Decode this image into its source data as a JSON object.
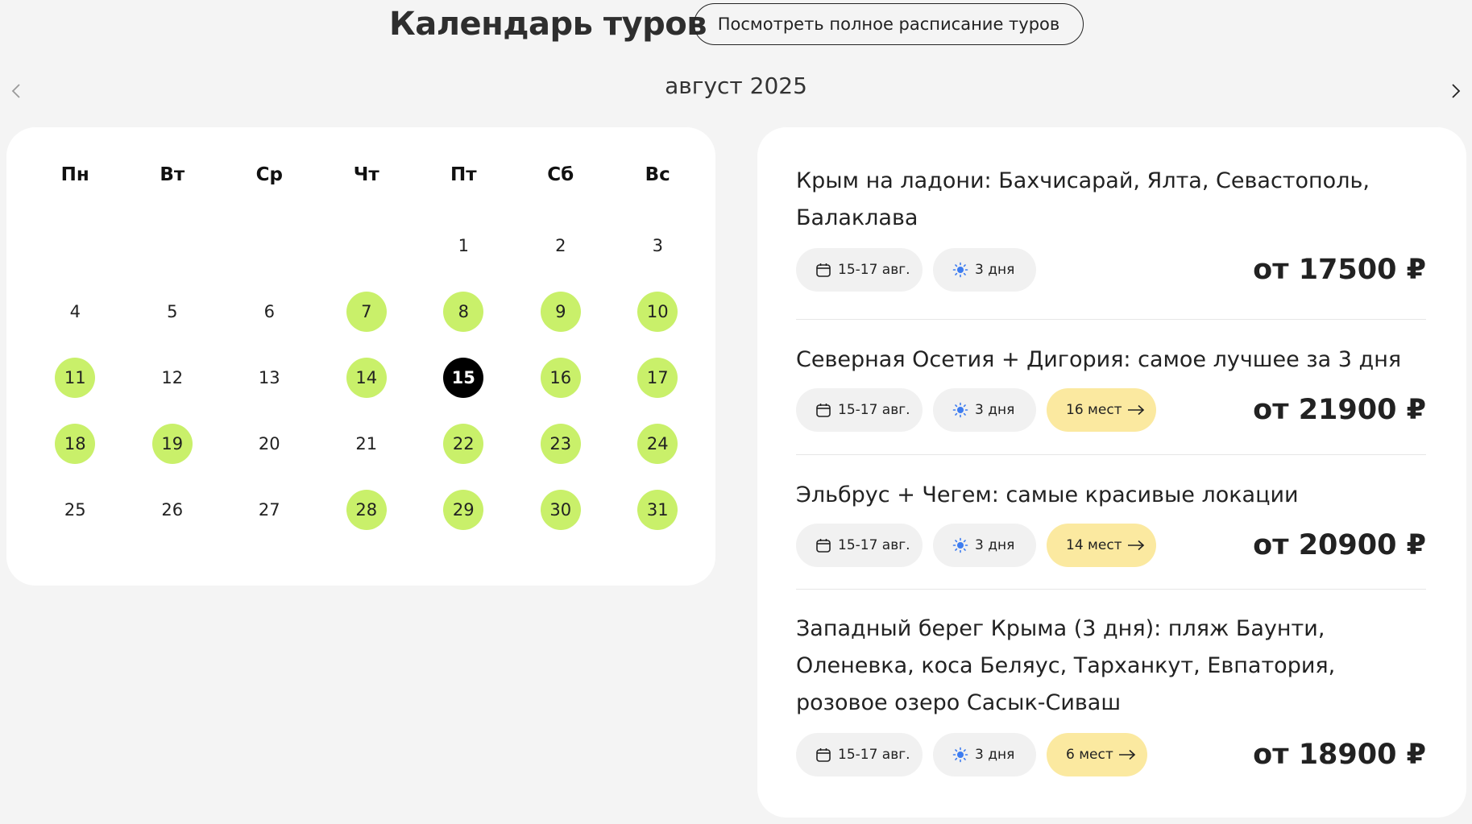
{
  "header": {
    "title": "Календарь туров",
    "schedule_button": "Посмотреть полное расписание туров"
  },
  "calendar": {
    "month": "август 2025",
    "weekdays": [
      "Пн",
      "Вт",
      "Ср",
      "Чт",
      "Пт",
      "Сб",
      "Вс"
    ],
    "weeks": [
      [
        "",
        "",
        "",
        "",
        "1",
        "2",
        "3"
      ],
      [
        "4",
        "5",
        "6",
        "7",
        "8",
        "9",
        "10"
      ],
      [
        "11",
        "12",
        "13",
        "14",
        "15",
        "16",
        "17"
      ],
      [
        "18",
        "19",
        "20",
        "21",
        "22",
        "23",
        "24"
      ],
      [
        "25",
        "26",
        "27",
        "28",
        "29",
        "30",
        "31"
      ]
    ],
    "available_days": [
      "7",
      "8",
      "9",
      "10",
      "11",
      "14",
      "16",
      "17",
      "18",
      "19",
      "22",
      "23",
      "24",
      "28",
      "29",
      "30",
      "31"
    ],
    "selected_day": "15",
    "available_color": "#c9f06a",
    "selected_color": "#000000"
  },
  "tours": [
    {
      "title": "Крым на ладони: Бахчисарай, Ялта, Севастополь, Балаклава",
      "dates": "15-17 авг.",
      "duration": "3 дня",
      "seats": "",
      "price": "от 17500 ₽"
    },
    {
      "title": "Северная Осетия + Дигория: самое лучшее за 3 дня",
      "dates": "15-17 авг.",
      "duration": "3 дня",
      "seats": "16 мест",
      "price": "от 21900 ₽"
    },
    {
      "title": "Эльбрус + Чегем: самые красивые локации",
      "dates": "15-17 авг.",
      "duration": "3 дня",
      "seats": "14 мест",
      "price": "от 20900 ₽"
    },
    {
      "title": "Западный берег Крыма (3 дня): пляж Баунти, Оленевка, коса Беляус, Тарханкут, Евпатория, розовое озеро Сасык-Сиваш",
      "dates": "15-17 авг.",
      "duration": "3 дня",
      "seats": "6 мест",
      "price": "от 18900 ₽"
    }
  ],
  "icons": {
    "prev": "chevron-left-icon",
    "next": "chevron-right-icon",
    "date": "calendar-icon",
    "duration": "sun-icon",
    "seats": "arrow-right-icon"
  },
  "colors": {
    "seats_badge": "#fbe9a0",
    "chip": "#f1f1f1",
    "sun": "#3d7cf0"
  }
}
